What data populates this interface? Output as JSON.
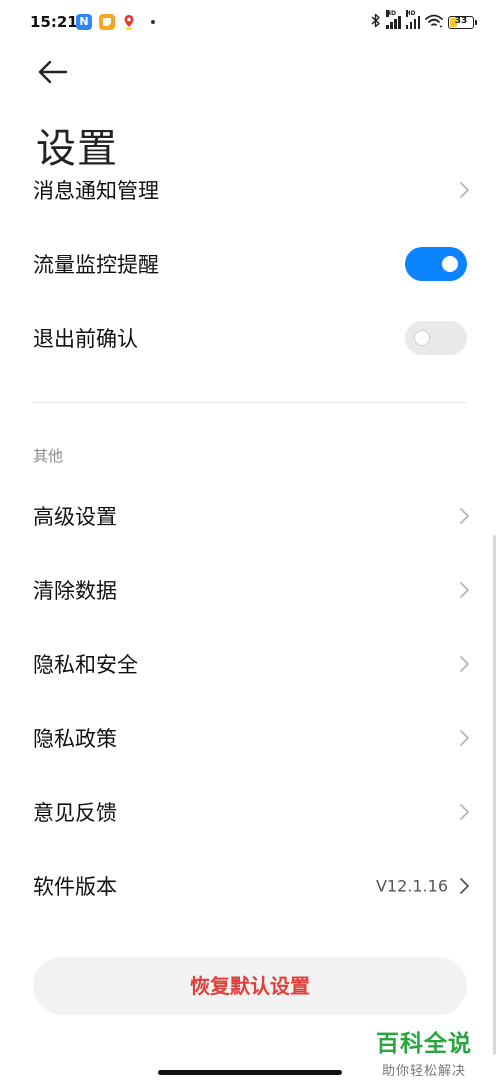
{
  "status_bar": {
    "time": "15:21",
    "app_icons": [
      {
        "name": "n-app-icon",
        "letter": "N",
        "color": "#2f86f6"
      },
      {
        "name": "notes-app-icon",
        "letter": "",
        "color": "#f5a623"
      },
      {
        "name": "location-pin-icon",
        "letter": "",
        "color": "#e53935"
      }
    ],
    "signal_badge_1": "HD",
    "signal_badge_2": "HD",
    "battery_level": "33",
    "battery_fill_percent": 33
  },
  "header": {
    "title": "设置"
  },
  "items": [
    {
      "label": "消息通知管理"
    },
    {
      "label": "流量监控提醒",
      "toggle": true
    },
    {
      "label": "退出前确认",
      "toggle": false
    }
  ],
  "section_other": {
    "title": "其他",
    "items": [
      {
        "label": "高级设置"
      },
      {
        "label": "清除数据"
      },
      {
        "label": "隐私和安全"
      },
      {
        "label": "隐私政策"
      },
      {
        "label": "意见反馈"
      },
      {
        "label": "软件版本",
        "value": "V12.1.16"
      }
    ]
  },
  "reset_button": {
    "label": "恢复默认设置"
  },
  "watermark": {
    "main": "百科全说",
    "sub": "助你轻松解决"
  },
  "colors": {
    "accent": "#0d84ff",
    "danger": "#e0403a",
    "watermark": "#2aa640"
  }
}
